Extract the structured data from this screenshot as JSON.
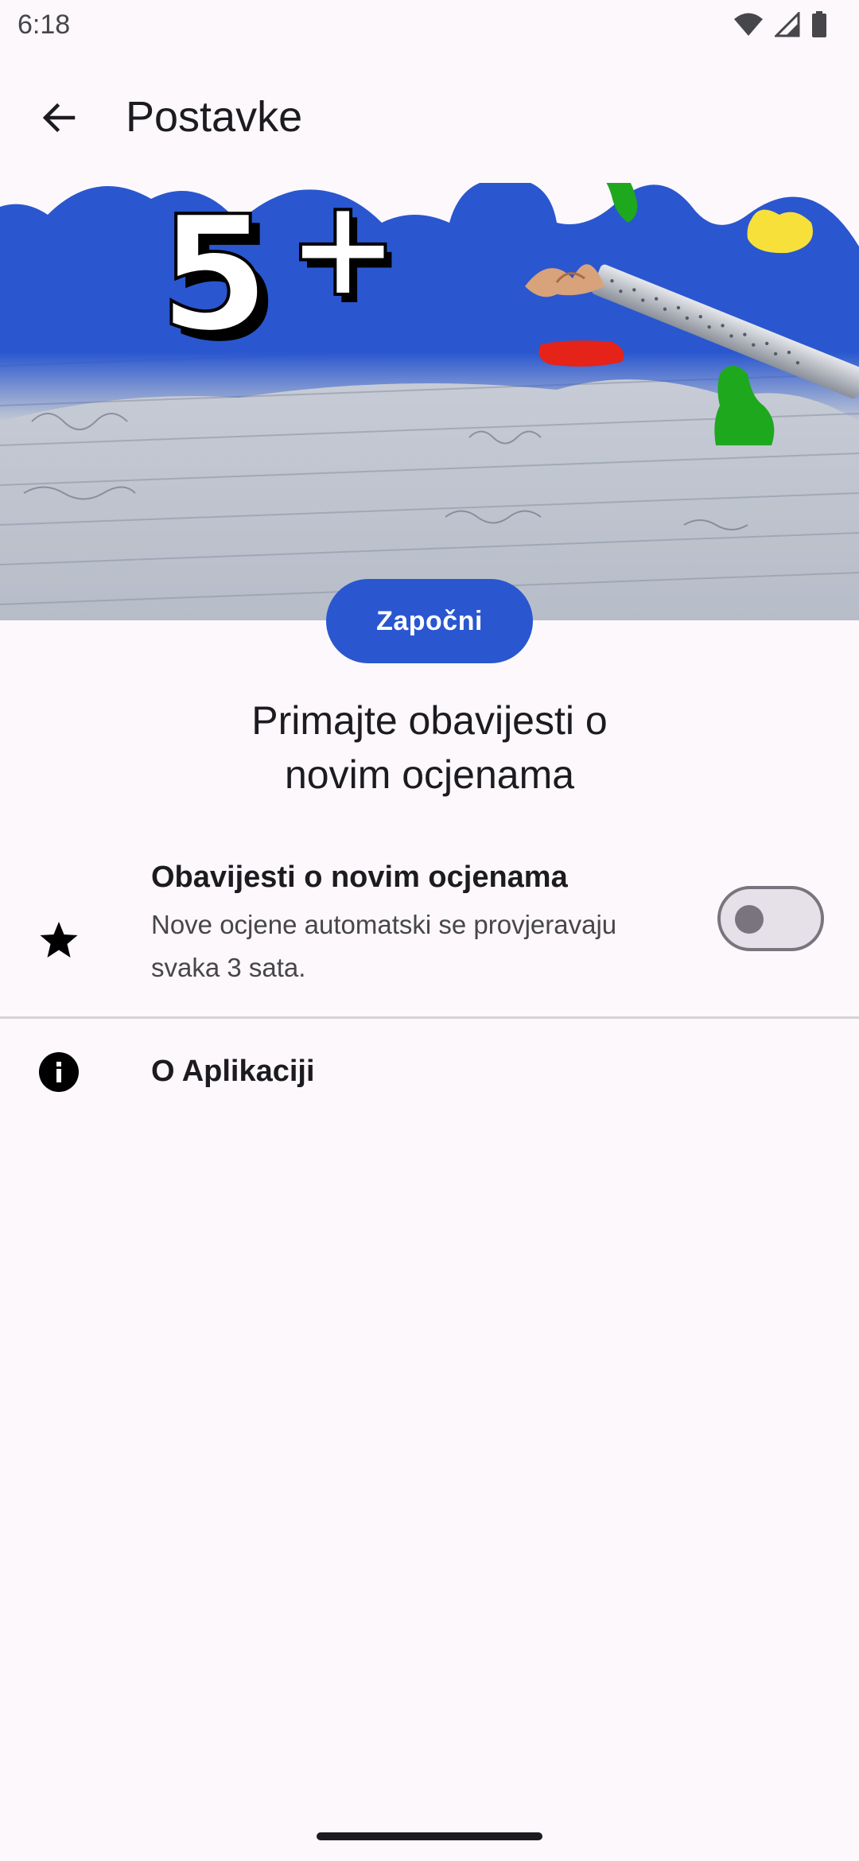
{
  "status_bar": {
    "time": "6:18",
    "icons": [
      "wifi-icon",
      "signal-icon",
      "battery-icon"
    ]
  },
  "app_bar": {
    "back_icon": "arrow-left-icon",
    "title": "Postavke"
  },
  "hero": {
    "logo_text": "5+",
    "start_button_label": "Započni"
  },
  "headline": {
    "line1": "Primajte obavijesti o",
    "line2": "novim ocjenama"
  },
  "settings": {
    "notifications": {
      "icon": "star-icon",
      "title": "Obavijesti o novim ocjenama",
      "description": "Nove ocjene automatski se provjeravaju svaka 3 sata.",
      "enabled": false
    },
    "about": {
      "icon": "info-icon",
      "title": "O Aplikaciji"
    }
  },
  "colors": {
    "accent": "#2a57cf",
    "background": "#fcf8fc",
    "text": "#1c1b1f",
    "secondary_text": "#47464a"
  }
}
